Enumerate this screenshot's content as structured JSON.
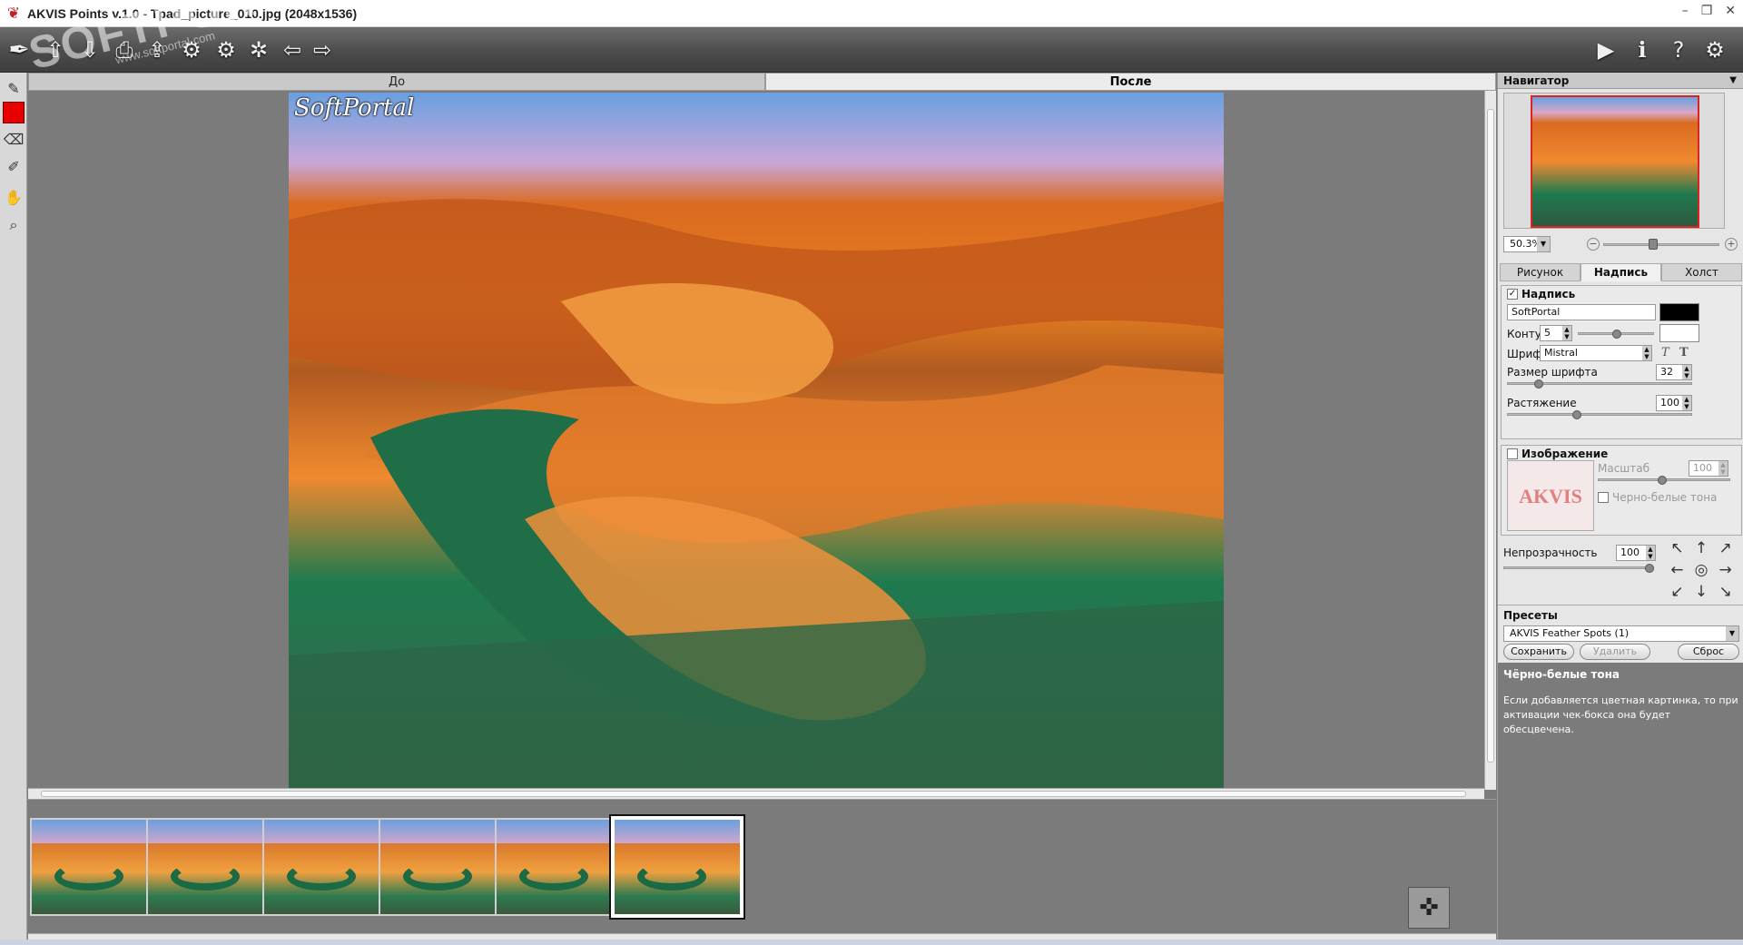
{
  "window": {
    "title": "AKVIS Points v.1.0 - Tpad_picture_010.jpg (2048x1536)",
    "logo_icon": "akvis-logo-icon",
    "minimize_icon": "minimize-icon",
    "restore_icon": "restore-icon",
    "close_icon": "close-icon"
  },
  "watermark": {
    "main": "SOFTPORTAL",
    "sub": "www.softportal.com"
  },
  "toolbar": {
    "left_icons": [
      "brush-logo-icon",
      "open-icon",
      "save-icon",
      "print-icon",
      "upload-icon",
      "import-settings-icon",
      "export-settings-icon",
      "settings-gear-icon",
      "undo-arrow-icon",
      "redo-arrow-icon"
    ],
    "right_icons": [
      "run-play-icon",
      "info-icon",
      "help-icon",
      "preferences-gear-icon"
    ]
  },
  "left_tools": [
    "brush-tool-icon",
    "color-swatch-icon",
    "eraser-icon",
    "history-brush-icon",
    "hand-icon",
    "zoom-icon"
  ],
  "left_swatch_color": "#e80000",
  "canvas": {
    "tab_before": "До",
    "tab_after": "После",
    "image_label": "SoftPortal"
  },
  "thumbnails": {
    "count": 6,
    "selected_index": 5
  },
  "navigator": {
    "title": "Навигатор",
    "zoom": "50.3%"
  },
  "panel_tabs": [
    "Рисунок",
    "Надпись",
    "Холст"
  ],
  "active_panel_tab": 1,
  "text_group": {
    "title": "Надпись",
    "checked": "✓",
    "text_value": "SoftPortal",
    "text_color": "#000000",
    "contour_label": "Контур",
    "contour_value": "5",
    "contour_color": "#ffffff",
    "font_label": "Шрифт",
    "font_value": "Mistral",
    "italic_icon": "T",
    "bold_icon": "T",
    "size_label": "Размер шрифта",
    "size_value": "32",
    "stretch_label": "Растяжение",
    "stretch_value": "100"
  },
  "image_group": {
    "title": "Изображение",
    "logo_text": "AKVIS",
    "scale_label": "Масштаб",
    "scale_value": "100",
    "bw_label": "Черно-белые тона"
  },
  "opacity": {
    "label": "Непрозрачность",
    "value": "100"
  },
  "direction_icons": [
    "↖",
    "↑",
    "↗",
    "←",
    "◎",
    "→",
    "↙",
    "↓",
    "↘"
  ],
  "presets": {
    "title": "Пресеты",
    "selected": "AKVIS Feather Spots (1)",
    "save": "Сохранить",
    "delete": "Удалить",
    "reset": "Сброс"
  },
  "hint": {
    "title": "Чёрно-белые тона",
    "body": "Если добавляется цветная картинка, то при активации чек-бокса она будет обесцвечена."
  }
}
